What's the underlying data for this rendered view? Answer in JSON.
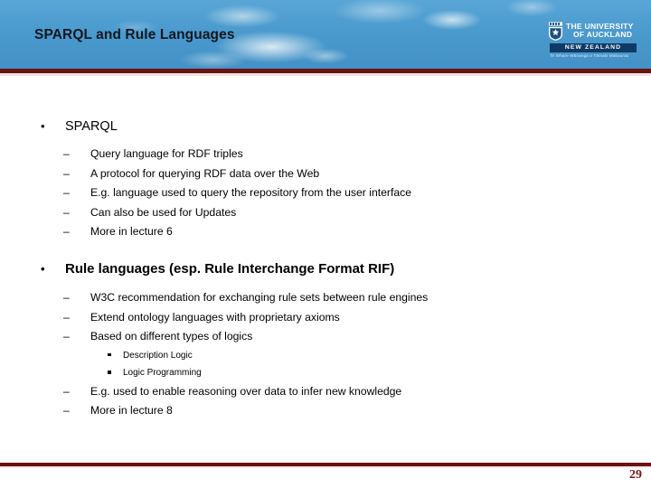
{
  "slide": {
    "title": "SPARQL and Rule Languages",
    "number": "29"
  },
  "logo": {
    "line1": "THE UNIVERSITY",
    "line2": "OF AUCKLAND",
    "banner": "NEW ZEALAND",
    "motto": "Te Whare Wānanga o Tāmaki Makaurau"
  },
  "colors": {
    "sky": "#4b9ace",
    "rule_dark_red": "#6b1212",
    "rule_light": "#f2e2e3",
    "slide_number": "#7a1515",
    "logo_navy": "#0e3a66",
    "title_text": "#14161f"
  },
  "body": {
    "sections": [
      {
        "heading": "SPARQL",
        "bold": false,
        "items": [
          "Query language for RDF triples",
          "A protocol for querying RDF data over the Web",
          "E.g. language used to query the repository from the user interface",
          "Can also be used for Updates",
          "More in lecture 6"
        ]
      },
      {
        "heading": "Rule languages (esp. Rule Interchange Format RIF)",
        "bold": true,
        "items": [
          "W3C recommendation for exchanging rule sets between rule engines",
          "Extend ontology languages with proprietary axioms",
          "Based on different types of logics"
        ],
        "subitems": [
          "Description Logic",
          "Logic Programming"
        ],
        "items_after": [
          "E.g. used to enable reasoning over data to infer new knowledge",
          "More in lecture 8"
        ]
      }
    ]
  },
  "glyphs": {
    "dot": "•",
    "dash": "–"
  }
}
